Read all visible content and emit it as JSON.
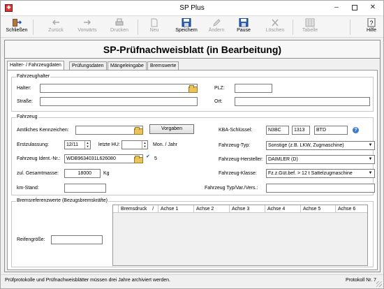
{
  "window": {
    "title": "SP Plus"
  },
  "toolbar": {
    "close": "Schließen",
    "back": "Zurück",
    "forward": "Vorwärts",
    "print": "Drucken",
    "new": "Neu",
    "save": "Speichern",
    "edit": "Ändern",
    "pause": "Pause",
    "delete": "Löschen",
    "table": "Tabelle",
    "help": "Hilfe"
  },
  "heading": "SP-Prüfnachweisblatt (in Bearbeitung)",
  "tabs": [
    "Halter- / Fahrzeugdaten",
    "Prüfungsdaten",
    "Mängeleingabe",
    "Bremswerte"
  ],
  "fahrzeughalter": {
    "group_label": "Fahrzeughalter",
    "halter_label": "Halter:",
    "halter_value": "",
    "strasse_label": "Straße:",
    "strasse_value": "",
    "plz_label": "PLZ:",
    "plz_value": "",
    "ort_label": "Ort:",
    "ort_value": ""
  },
  "fahrzeug": {
    "group_label": "Fahrzeug",
    "kennzeichen_label": "Amtliches Kennzeichen:",
    "kennzeichen_value": "",
    "vorgaben_button": "Vorgaben",
    "erstzulassung_label": "Erstzulassung:",
    "erstzulassung_value": "12/11",
    "letzte_hu_label": "letzte HU:",
    "letzte_hu_value": "",
    "mon_jahr": "Mon. / Jahr",
    "ident_label": "Fahrzeug Ident.-Nr.:",
    "ident_value": "WDB9634031L626080",
    "ident_check_count": "5",
    "gesamtmasse_label": "zul. Gesamtmasse:",
    "gesamtmasse_value": "18000",
    "gesamtmasse_unit": "Kg",
    "kmstand_label": "km-Stand:",
    "kmstand_value": "",
    "kba_label": "KBA-Schlüssel:",
    "kba_values": [
      "N3BC",
      "1313",
      "BTD"
    ],
    "typ_label": "Fahrzeug-Typ:",
    "typ_value": "Sonstige (z.B. LKW, Zugmaschine)",
    "hersteller_label": "Fahrzeug-Hersteller:",
    "hersteller_value": "DAIMLER (D)",
    "klasse_label": "Fahrzeug-Klasse:",
    "klasse_value": "Fz.z.Güt.bef. > 12 t Sattelzugmaschine",
    "typ_var_label": "Fahrzeug Typ/Var./Vers.:",
    "typ_var_value": ""
  },
  "bremsreferenz": {
    "group_label": "Bremsreferenzwerte (Bezugsbremskräfte)",
    "reifen_label": "Reifengröße:",
    "reifen_value": "",
    "columns": [
      "Bremsdruck",
      "Achse 1",
      "Achse 2",
      "Achse 3",
      "Achse 4",
      "Achse 5",
      "Achse 6"
    ],
    "sort_indicator": "/"
  },
  "status": {
    "left": "Prüfprotokolle und Prüfnachweisblätter müssen drei Jahre archiviert werden.",
    "right": "Protokoll Nr. 7"
  }
}
